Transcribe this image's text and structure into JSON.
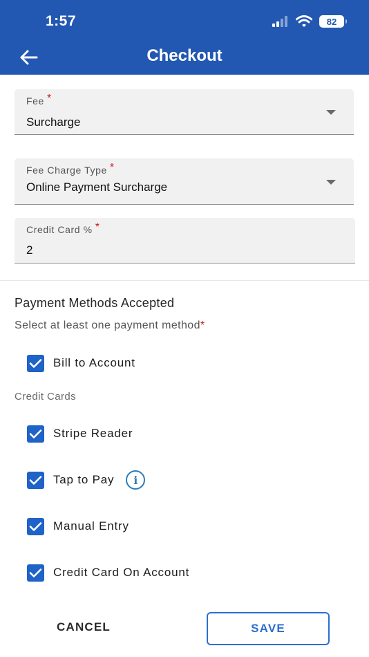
{
  "status_bar": {
    "time": "1:57",
    "battery": "82"
  },
  "header": {
    "title": "Checkout"
  },
  "fields": {
    "fee": {
      "label": "Fee",
      "required_mark": "*",
      "value": "Surcharge"
    },
    "fee_charge_type": {
      "label": "Fee Charge Type",
      "required_mark": "*",
      "value": "Online Payment Surcharge"
    },
    "credit_card_pct": {
      "label": "Credit Card %",
      "required_mark": "*",
      "value": "2"
    }
  },
  "payment_methods": {
    "title": "Payment Methods Accepted",
    "subtitle": "Select at least one payment method",
    "required_mark": "*",
    "bill_to_account": {
      "label": "Bill to Account",
      "checked": true
    },
    "credit_cards_label": "Credit Cards",
    "credit_cards": [
      {
        "label": "Stripe Reader",
        "checked": true
      },
      {
        "label": "Tap to Pay",
        "checked": true
      },
      {
        "label": "Manual Entry",
        "checked": true
      },
      {
        "label": "Credit Card On Account",
        "checked": true
      }
    ]
  },
  "actions": {
    "cancel_label": "CANCEL",
    "save_label": "SAVE"
  },
  "colors": {
    "header": "#2358b2",
    "checkbox": "#1f62c8",
    "accent": "#2c6fcc",
    "required": "#d01818",
    "info": "#2e7bb8"
  },
  "icons": {
    "back": "arrow-left-icon",
    "signal": "signal-bars-icon",
    "wifi": "wifi-icon",
    "battery": "battery-icon",
    "check": "checkmark-icon",
    "info": "info-circle-icon",
    "dropdown": "caret-down-icon"
  }
}
